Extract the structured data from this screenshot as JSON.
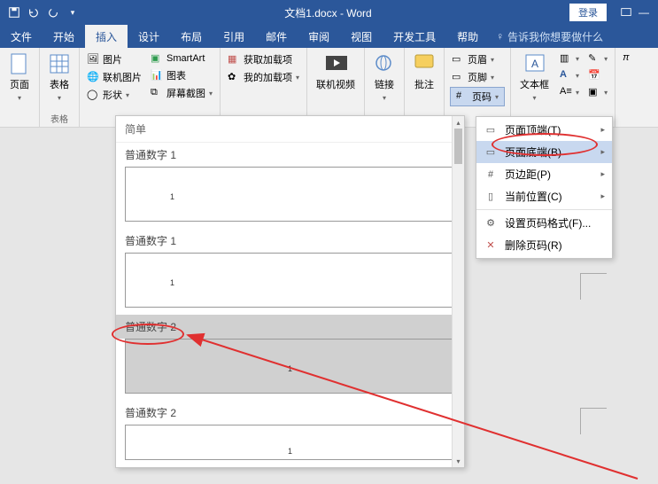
{
  "titlebar": {
    "doc_title": "文档1.docx - Word",
    "login": "登录"
  },
  "tabs": {
    "file": "文件",
    "home": "开始",
    "insert": "插入",
    "design": "设计",
    "layout": "布局",
    "references": "引用",
    "mailings": "邮件",
    "review": "审阅",
    "view": "视图",
    "developer": "开发工具",
    "help": "帮助",
    "tell_me": "告诉我你想要做什么"
  },
  "ribbon": {
    "pages": {
      "label": "页面"
    },
    "tables": {
      "big": "表格",
      "label": "表格"
    },
    "illus": {
      "pic": "图片",
      "online_pic": "联机图片",
      "shapes": "形状",
      "smartart": "SmartArt",
      "chart": "图表",
      "screenshot": "屏幕截图"
    },
    "addins": {
      "get": "获取加载项",
      "my": "我的加载项"
    },
    "media": {
      "online_video": "联机视频"
    },
    "links": {
      "label": "链接"
    },
    "comments": {
      "label": "批注"
    },
    "header_footer": {
      "header": "页眉",
      "footer": "页脚",
      "page_number": "页码"
    },
    "text": {
      "textbox": "文本框"
    }
  },
  "dropdown": {
    "section": "简单",
    "item1": "普通数字 1",
    "item1b": "普通数字 1",
    "item2": "普通数字 2",
    "item2b": "普通数字 2",
    "sample1": "1",
    "sample2": "1"
  },
  "submenu": {
    "top": "页面顶端(T)",
    "bottom": "页面底端(B)",
    "margins": "页边距(P)",
    "current": "当前位置(C)",
    "format": "设置页码格式(F)...",
    "remove": "删除页码(R)"
  }
}
